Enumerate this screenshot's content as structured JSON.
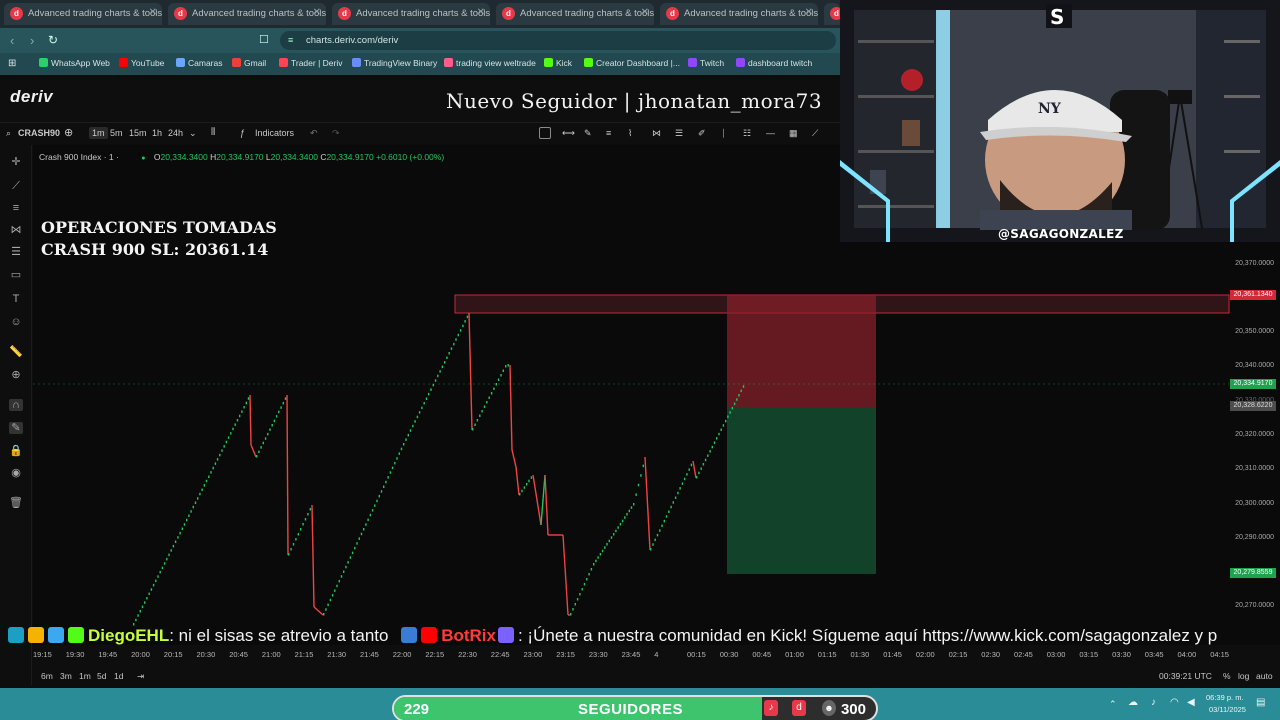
{
  "browser": {
    "tabs": [
      {
        "title": "Advanced trading charts & tools | Tr"
      },
      {
        "title": "Advanced trading charts & tools | Tr"
      },
      {
        "title": "Advanced trading charts & tools | Tr"
      },
      {
        "title": "Advanced trading charts & tools | Tr"
      },
      {
        "title": "Advanced trading charts & tools | Tr"
      }
    ],
    "url": "charts.deriv.com/deriv",
    "bookmarks": [
      {
        "label": "WhatsApp Web",
        "color": "#25d366"
      },
      {
        "label": "YouTube",
        "color": "#ff0000"
      },
      {
        "label": "Camaras",
        "color": "#6aa5ff"
      },
      {
        "label": "Gmail",
        "color": "#ea4335"
      },
      {
        "label": "Trader | Deriv",
        "color": "#ff444f"
      },
      {
        "label": "TradingView Binary",
        "color": "#6b8cff"
      },
      {
        "label": "trading view weltrade",
        "color": "#ff5c8a"
      },
      {
        "label": "Kick",
        "color": "#53fc18"
      },
      {
        "label": "Creator Dashboard |...",
        "color": "#53fc18"
      },
      {
        "label": "Twitch",
        "color": "#9146ff"
      },
      {
        "label": "dashboard twitch",
        "color": "#9146ff"
      }
    ]
  },
  "deriv": {
    "logo": "deriv",
    "follower_alert": "Nuevo Seguidor | jhonatan_mora73"
  },
  "toolbar": {
    "symbol": "CRASH90",
    "intervals": [
      "1m",
      "5m",
      "15m",
      "1h",
      "24h"
    ],
    "selected_interval": "1m",
    "indicators_label": "Indicators"
  },
  "legend": {
    "instrument": "Crash 900 Index · 1 ·",
    "o_label": "O",
    "o": "20,334.3400",
    "h_label": "H",
    "h": "20,334.9170",
    "l_label": "L",
    "l": "20,334.3400",
    "c_label": "C",
    "c": "20,334.9170",
    "change": "+0.6010 (+0.00%)"
  },
  "overlay": {
    "line1": "OPERACIONES TOMADAS",
    "line2": "CRASH 900 SL: 20361.14"
  },
  "price_axis": {
    "labels": [
      "20,370.0000",
      "20,350.0000",
      "20,340.0000",
      "20,330.0000",
      "20,320.0000",
      "20,310.0000",
      "20,300.0000",
      "20,290.0000",
      "20,270.0000"
    ],
    "sl_tag": "20,361.1340",
    "current_tag": "20,334.9170",
    "entry_tag": "20,328.6220",
    "tp_tag": "20,279.8559",
    "sl_color": "#e0293b",
    "up_color": "#22c55e",
    "down_color": "#ef4444"
  },
  "time_axis": [
    "19:15",
    "19:30",
    "19:45",
    "20:00",
    "20:15",
    "20:30",
    "20:45",
    "21:00",
    "21:15",
    "21:30",
    "21:45",
    "22:00",
    "22:15",
    "22:30",
    "22:45",
    "23:00",
    "23:15",
    "23:30",
    "23:45",
    "4",
    "00:15",
    "00:30",
    "00:45",
    "01:00",
    "01:15",
    "01:30",
    "01:45",
    "02:00",
    "02:15",
    "02:30",
    "02:45",
    "03:00",
    "03:15",
    "03:30",
    "03:45",
    "04:00",
    "04:15"
  ],
  "bottom": {
    "ranges": [
      "6m",
      "3m",
      "1m",
      "5d",
      "1d"
    ],
    "clock": "00:39:21 UTC",
    "pct": "%",
    "log": "log",
    "auto": "auto"
  },
  "ticker": {
    "name": "DiegoEHL",
    "msg1": ": ni el sisas se atrevio a tanto",
    "brand": "BotRix",
    "msg2": ": ¡Únete a nuestra comunidad en Kick! Sígueme aquí https://www.kick.com/sagagonzalez y p"
  },
  "followers": {
    "current": "229",
    "label": "SEGUIDORES",
    "goal": "300",
    "progress": 0.7633
  },
  "taskbar": {
    "time": "06:39 p. m.",
    "date": "03/11/2025"
  },
  "webcam": {
    "handle": "@SAGAGONZALEZ"
  }
}
